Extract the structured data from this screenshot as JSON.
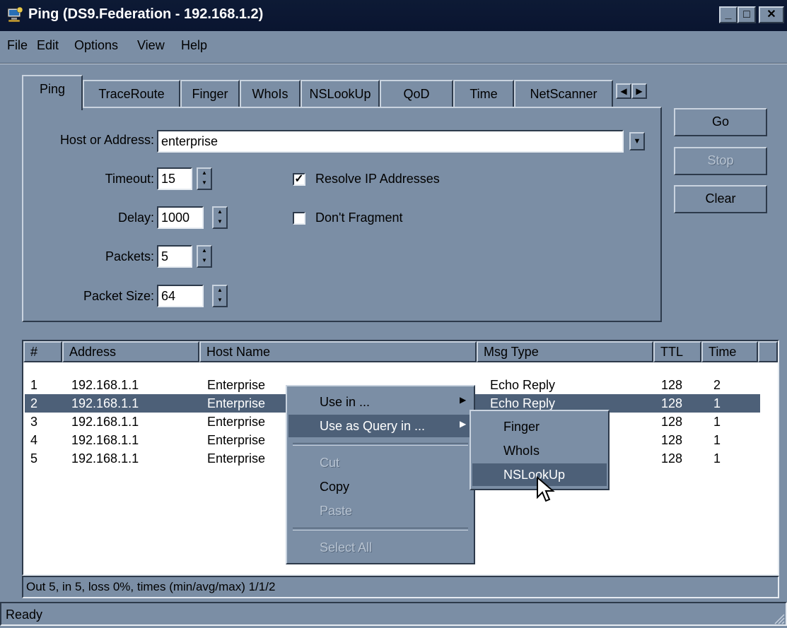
{
  "window": {
    "title": "Ping (DS9.Federation - 192.168.1.2)",
    "minimize": "_",
    "maximize": "□",
    "close": "✕"
  },
  "menubar": {
    "file": "File",
    "edit": "Edit",
    "options": "Options",
    "view": "View",
    "help": "Help"
  },
  "tabs": [
    "Ping",
    "TraceRoute",
    "Finger",
    "WhoIs",
    "NSLookUp",
    "QoD",
    "Time",
    "NetScanner"
  ],
  "form": {
    "host_label": "Host or Address:",
    "host_value": "enterprise",
    "timeout_label": "Timeout:",
    "timeout_value": "15",
    "delay_label": "Delay:",
    "delay_value": "1000",
    "packets_label": "Packets:",
    "packets_value": "5",
    "packet_size_label": "Packet Size:",
    "packet_size_value": "64",
    "resolve_label": "Resolve IP Addresses",
    "resolve_checked": true,
    "fragment_label": "Don't Fragment",
    "fragment_checked": false
  },
  "buttons": {
    "go": "Go",
    "stop": "Stop",
    "clear": "Clear"
  },
  "table": {
    "columns": [
      "#",
      "Address",
      "Host Name",
      "Msg Type",
      "TTL",
      "Time"
    ],
    "rows": [
      [
        "1",
        "192.168.1.1",
        "Enterprise",
        "Echo Reply",
        "128",
        "2"
      ],
      [
        "2",
        "192.168.1.1",
        "Enterprise",
        "Echo Reply",
        "128",
        "1"
      ],
      [
        "3",
        "192.168.1.1",
        "Enterprise",
        "",
        "128",
        "1"
      ],
      [
        "4",
        "192.168.1.1",
        "Enterprise",
        "",
        "128",
        "1"
      ],
      [
        "5",
        "192.168.1.1",
        "Enterprise",
        "",
        "128",
        "1"
      ]
    ],
    "selected_row": 2
  },
  "summary": "Out 5, in 5, loss 0%, times (min/avg/max) 1/1/2",
  "status": "Ready",
  "context_menu": {
    "use_in": "Use in ...",
    "use_as_query": "Use as Query in ...",
    "cut": "Cut",
    "copy": "Copy",
    "paste": "Paste",
    "select_all": "Select All"
  },
  "submenu": {
    "finger": "Finger",
    "whois": "WhoIs",
    "nslookup": "NSLookUp"
  },
  "colors": {
    "face": "#7b8ea5",
    "highlight": "#4d6078",
    "titlebar": "#0a1530"
  }
}
